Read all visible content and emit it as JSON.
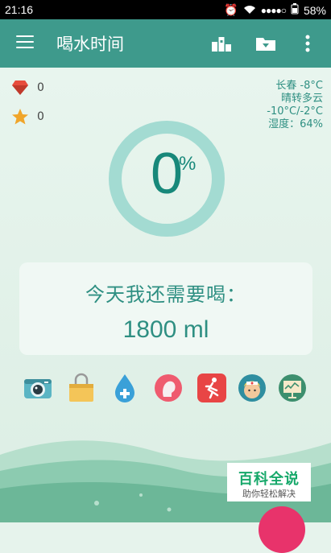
{
  "status_bar": {
    "time": "21:16",
    "battery": "58%"
  },
  "app_bar": {
    "title": "喝水时间"
  },
  "stats": {
    "gems": "0",
    "stars": "0"
  },
  "weather": {
    "city_temp": "长春 -8°C",
    "condition": "晴转多云",
    "range": "-10°C/-2°C",
    "humidity": "湿度：64%"
  },
  "progress": {
    "value": "0",
    "unit": "%"
  },
  "need": {
    "label": "今天我还需要喝：",
    "amount": "1800 ml"
  },
  "badge": {
    "title": "百科全说",
    "subtitle": "助你轻松解决"
  },
  "toolbar_icons": [
    "camera-icon",
    "bag-icon",
    "water-drop-plus-icon",
    "profile-icon",
    "running-icon",
    "nurse-icon",
    "presentation-icon"
  ],
  "colors": {
    "primary": "#3e9a8c",
    "accent_text": "#2e8f82",
    "ring": "#a3dbd2",
    "fab": "#e8336b"
  }
}
